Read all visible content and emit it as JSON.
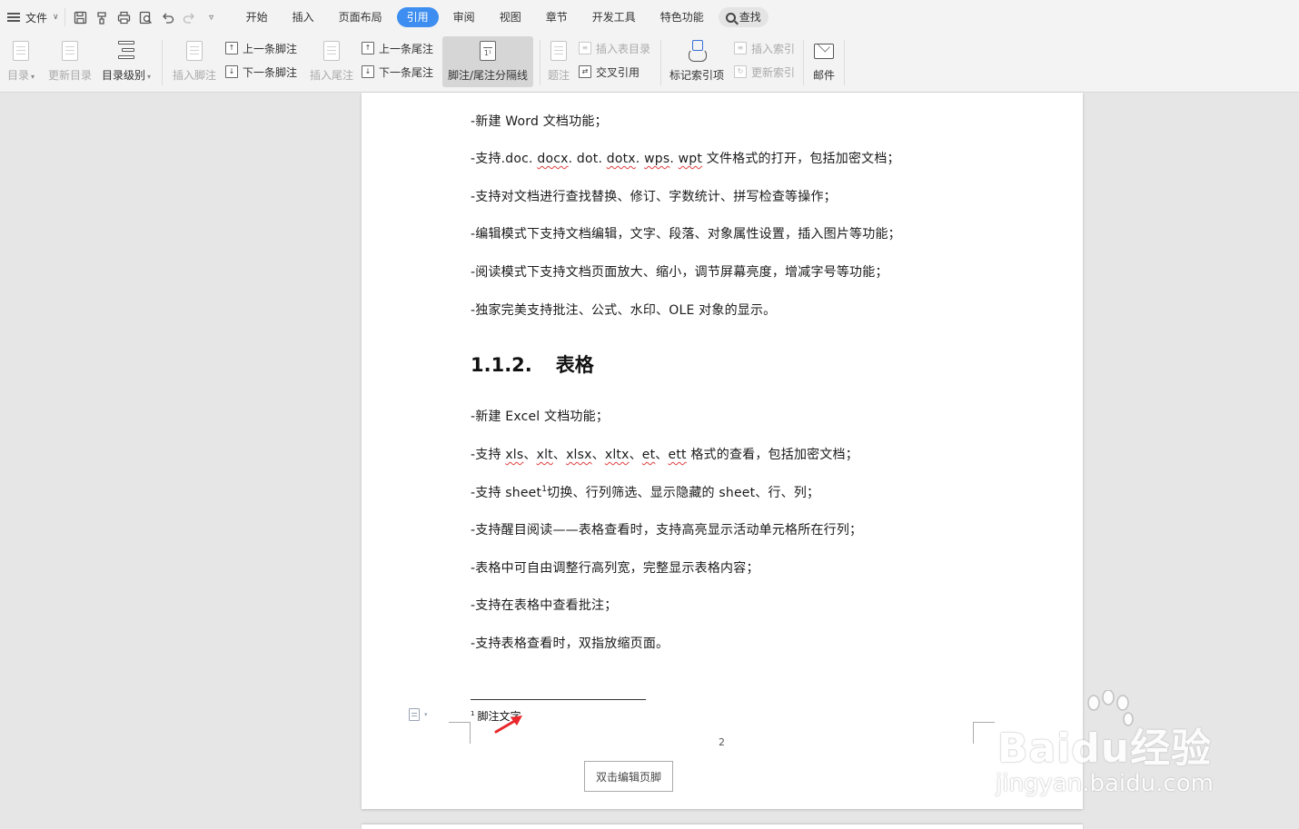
{
  "menubar": {
    "file_label": "文件",
    "tabs": [
      {
        "label": "开始"
      },
      {
        "label": "插入"
      },
      {
        "label": "页面布局"
      },
      {
        "label": "引用",
        "active": true
      },
      {
        "label": "审阅"
      },
      {
        "label": "视图"
      },
      {
        "label": "章节"
      },
      {
        "label": "开发工具"
      },
      {
        "label": "特色功能"
      }
    ],
    "search_label": "查找",
    "quick_access_icons": [
      "save-icon",
      "format-painter-icon",
      "print-icon",
      "print-preview-icon",
      "undo-icon",
      "redo-icon",
      "customize-icon"
    ]
  },
  "ribbon": {
    "toc": "目录",
    "update_toc": "更新目录",
    "toc_level": "目录级别",
    "insert_footnote": "插入脚注",
    "prev_footnote": "上一条脚注",
    "next_footnote": "下一条脚注",
    "insert_endnote": "插入尾注",
    "prev_endnote": "上一条尾注",
    "next_endnote": "下一条尾注",
    "separator": "脚注/尾注分隔线",
    "caption": "题注",
    "insert_table_of_figures": "插入表目录",
    "cross_reference": "交叉引用",
    "mark_index": "标记索引项",
    "insert_index": "插入索引",
    "update_index": "更新索引",
    "mail": "邮件"
  },
  "document": {
    "paragraphs_word": [
      "-新建 Word 文档功能；",
      "-支持对文档进行查找替换、修订、字数统计、拼写检查等操作；",
      "-编辑模式下支持文档编辑，文字、段落、对象属性设置，插入图片等功能；",
      "-阅读模式下支持文档页面放大、缩小，调节屏幕亮度，增减字号等功能；",
      "-独家完美支持批注、公式、水印、OLE 对象的显示。"
    ],
    "formats_line": {
      "prefix": "-支持.doc. ",
      "w1": "docx",
      "m1": ". dot. ",
      "w2": "dotx",
      "m2": ". ",
      "w3": "wps",
      "m3": ". ",
      "w4": "wpt",
      "suffix": "  文件格式的打开，包括加密文档；"
    },
    "heading_number": "1.1.2.",
    "heading_text": "表格",
    "excel_line1": "-新建 Excel 文档功能；",
    "xls_line": {
      "prefix": "-支持 ",
      "w1": "xls",
      "s1": "、",
      "w2": "xlt",
      "s2": "、",
      "w3": "xlsx",
      "s3": "、",
      "w4": "xltx",
      "s4": "、",
      "w5": "et",
      "s5": "、",
      "w6": "ett",
      "suffix": " 格式的查看，包括加密文档；"
    },
    "sheet_line": {
      "prefix": "-支持 sheet",
      "ref": "1",
      "suffix": "切换、行列筛选、显示隐藏的 sheet、行、列；"
    },
    "paragraphs_excel": [
      "-支持醒目阅读——表格查看时，支持高亮显示活动单元格所在行列；",
      "-表格中可自由调整行高列宽，完整显示表格内容；",
      "-支持在表格中查看批注；",
      "-支持表格查看时，双指放缩页面。"
    ],
    "footnote_ref": "1",
    "footnote_text": "脚注文字",
    "page_number": "2",
    "footer_button": "双击编辑页脚"
  },
  "watermark": {
    "brand": "Baidu经验",
    "url": "jingyan.baidu.com"
  },
  "colors": {
    "accent": "#3d8ef0",
    "squiggle": "#e04040",
    "arrow": "#e8262b"
  }
}
